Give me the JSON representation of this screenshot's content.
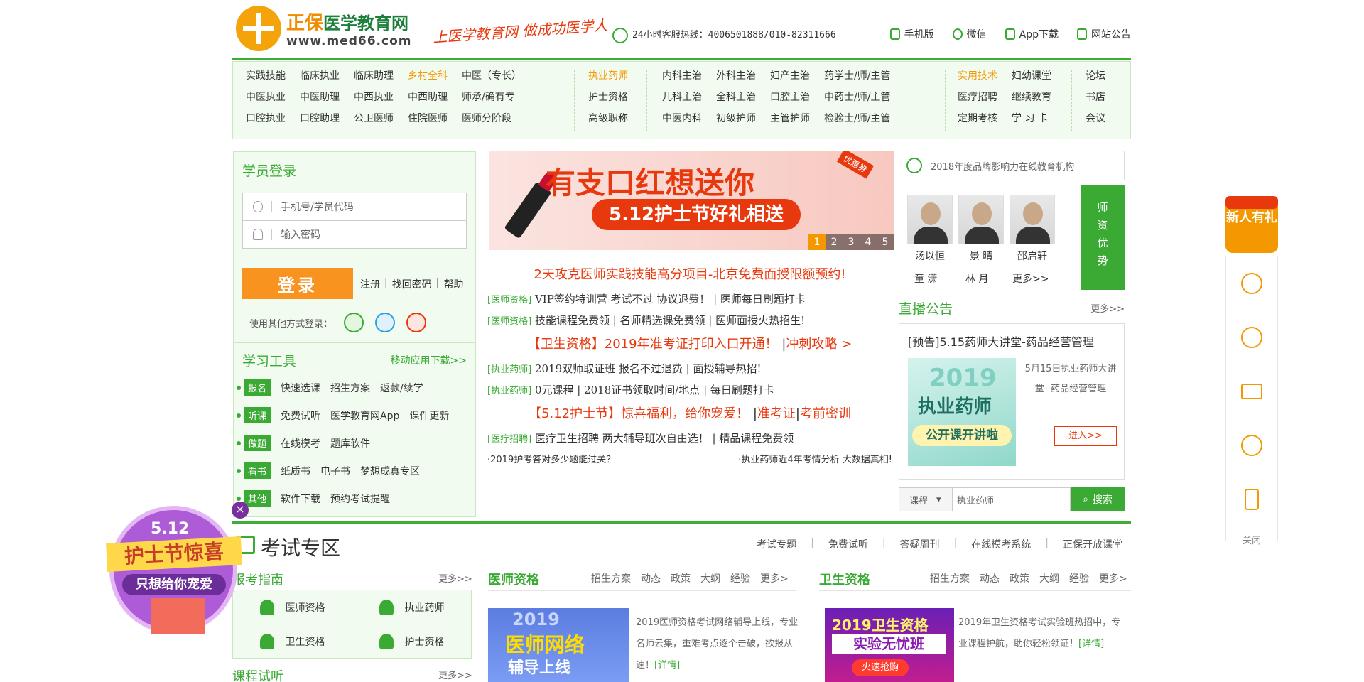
{
  "header": {
    "logo_brand": "正保",
    "logo_name": "医学教育网",
    "logo_url": "www.med66.com",
    "slogan": "上医学教育网 做成功医学人",
    "hotline": "24小时客服热线：4006501888/010-82311666",
    "links": [
      "手机版",
      "微信",
      "App下载",
      "网站公告"
    ]
  },
  "nav": {
    "col1": [
      "实践技能",
      "临床执业",
      "临床助理",
      "乡村全科",
      "中医（专长）",
      "中医执业",
      "中医助理",
      "中西执业",
      "中西助理",
      "师承/确有专",
      "口腔执业",
      "口腔助理",
      "公卫医师",
      "住院医师",
      "医师分阶段"
    ],
    "col1_highlight": "乡村全科",
    "col2": [
      "执业药师",
      "护士资格",
      "高级职称"
    ],
    "col3": [
      "内科主治",
      "外科主治",
      "妇产主治",
      "药学士/师/主管",
      "儿科主治",
      "全科主治",
      "口腔主治",
      "中药士/师/主管",
      "中医内科",
      "初级护师",
      "主管护师",
      "检验士/师/主管"
    ],
    "col4": [
      "实用技术",
      "妇幼课堂",
      "医疗招聘",
      "继续教育",
      "定期考核",
      "学 习 卡"
    ],
    "col5": [
      "论坛",
      "书店",
      "会议"
    ]
  },
  "login": {
    "title": "学员登录",
    "user_placeholder": "手机号/学员代码",
    "pass_placeholder": "输入密码",
    "login_button": "登录",
    "register": "注册",
    "find_password": "找回密码",
    "help": "帮助",
    "other_login": "使用其他方式登录："
  },
  "tools": {
    "title": "学习工具",
    "mobile_link": "移动应用下载>>",
    "rows": [
      {
        "tag": "报名",
        "items": [
          "快速选课",
          "招生方案",
          "返款/续学"
        ]
      },
      {
        "tag": "听课",
        "items": [
          "免费试听",
          "医学教育网App",
          "课件更新"
        ]
      },
      {
        "tag": "做题",
        "items": [
          "在线模考",
          "题库软件"
        ]
      },
      {
        "tag": "看书",
        "items": [
          "纸质书",
          "电子书",
          "梦想成真专区"
        ]
      },
      {
        "tag": "其他",
        "items": [
          "软件下载",
          "预约考试提醒"
        ]
      }
    ]
  },
  "banner": {
    "line1": "有支口红想送你",
    "line2": "5.12护士节好礼相送",
    "coupon": "优惠券",
    "pages": [
      "1",
      "2",
      "3",
      "4",
      "5"
    ]
  },
  "news": {
    "headline1": "2天攻克医师实践技能高分项目-北京免费面授限额预约!",
    "row1": {
      "cat": "[医师资格]",
      "text": "VIP签约特训营 考试不过 协议退费！ | 医师每日刷题打卡"
    },
    "row2": {
      "cat": "[医师资格]",
      "text": "技能课程免费领 | 名师精选课免费领 | 医师面授火热招生!"
    },
    "headline2_a": "【卫生资格】2019年准考证打印入口开通！",
    "headline2_b": "冲刺攻略 >",
    "row3": {
      "cat": "[执业药师]",
      "text": "2019双师取证班 报名不过退费 | 面授辅导热招!"
    },
    "row4": {
      "cat": "[执业药师]",
      "text": "0元课程 | 2018证书领取时间/地点 | 每日刷题打卡"
    },
    "headline3_a": "【5.12护士节】惊喜福利，给你宠爱！",
    "headline3_b": "准考证",
    "headline3_c": "考前密训",
    "row5": {
      "cat": "[医疗招聘]",
      "text": "医疗卫生招聘 两大辅导班次自由选！ | 精品课程免费领"
    },
    "small_left": "·2019护考答对多少题能过关？",
    "small_right": "·执业药师近4年考情分析 大数据真相!"
  },
  "brand": {
    "text": "2018年度品牌影响力在线教育机构"
  },
  "teachers": {
    "names": [
      "汤以恒",
      "景 晴",
      "邵启轩"
    ],
    "bottom": [
      "童 潇",
      "林 月",
      "更多>>"
    ],
    "side": "师资优势"
  },
  "live": {
    "title": "直播公告",
    "more": "更多>>",
    "item_title": "[预告]5.15药师大讲堂-药品经营管理",
    "img_year": "2019",
    "img_line1": "执业药师",
    "img_line2": "公开课开讲啦",
    "desc": "5月15日执业药师大讲堂--药品经营管理",
    "enter": "进入>>"
  },
  "search": {
    "select": "课程",
    "placeholder": "执业药师",
    "button": "搜索"
  },
  "exam": {
    "title": "考试专区",
    "links": [
      "考试专题",
      "免费试听",
      "答疑周刊",
      "在线模考系统",
      "正保开放课堂"
    ],
    "guide_title": "报考指南",
    "guide_more": "更多>>",
    "guide_items": [
      "医师资格",
      "执业药师",
      "卫生资格",
      "护士资格"
    ],
    "trial_title": "课程试听",
    "trial_more": "更多>>",
    "doctor_title": "医师资格",
    "doctor_tabs": [
      "招生方案",
      "动态",
      "政策",
      "大纲",
      "经验",
      "更多>"
    ],
    "doctor_img": [
      "2019",
      "医师网络",
      "辅导上线"
    ],
    "doctor_desc": "2019医师资格考试网络辅导上线，专业名师云集，重难考点逐个击破，欲报从速！",
    "detail": "[详情]",
    "health_title": "卫生资格",
    "health_tabs": [
      "招生方案",
      "动态",
      "政策",
      "大纲",
      "经验",
      "更多>"
    ],
    "health_img": [
      "2019卫生资格",
      "实验无忧班",
      "火速抢购"
    ],
    "health_desc": "2019年卫生资格考试实验班热招中，专业课程护航，助你轻松领证！"
  },
  "float": {
    "gift": "新人有礼",
    "close": "关闭",
    "icons": [
      "service-icon",
      "phone-icon",
      "mail-icon",
      "chat-icon",
      "mobile-icon"
    ]
  },
  "badge": {
    "line1": "5.12",
    "line2": "护士节惊喜",
    "line3": "只想给你宠爱"
  },
  "colors": {
    "green": "#3aaa35",
    "orange": "#f39800",
    "red": "#e8380d"
  }
}
